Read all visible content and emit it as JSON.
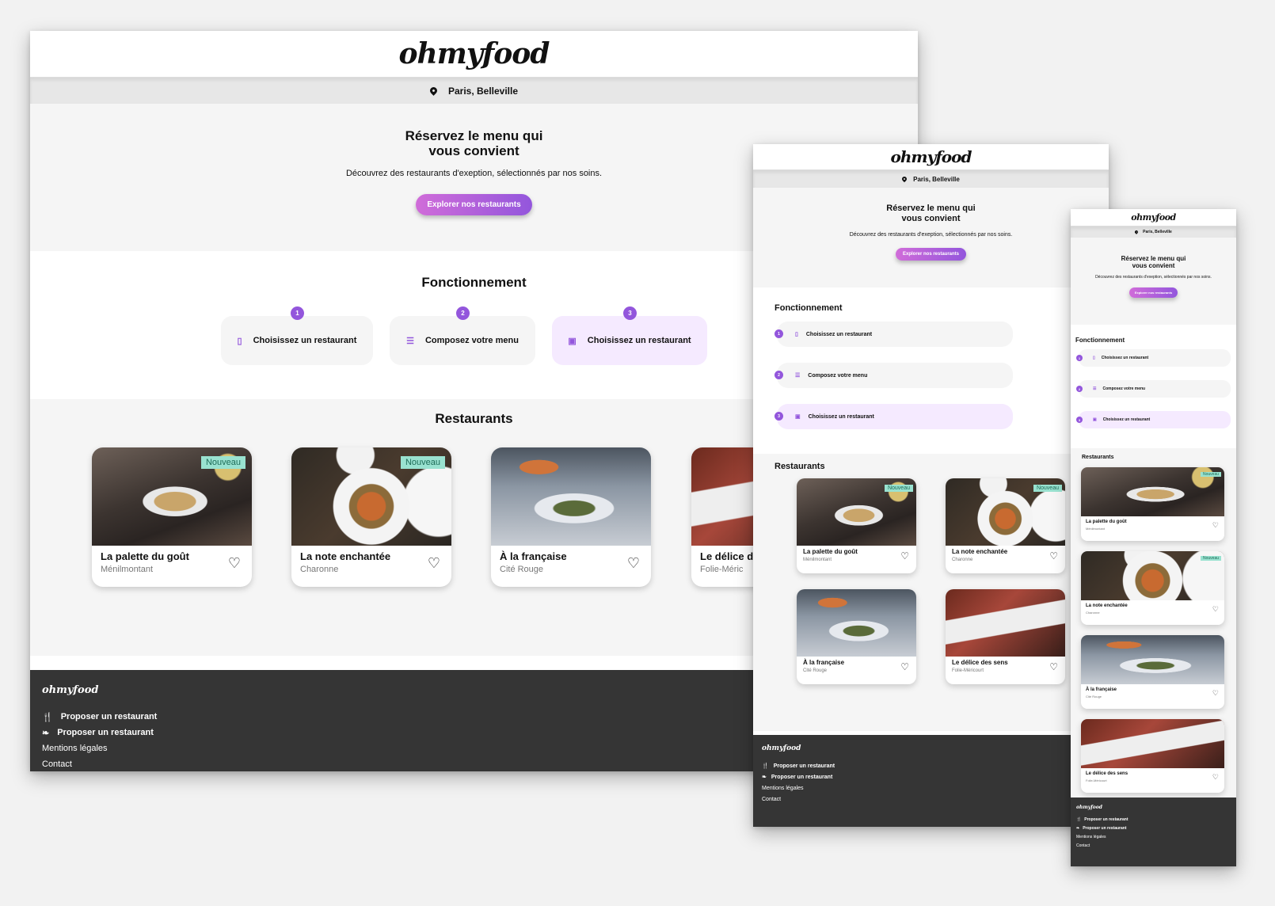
{
  "brand": {
    "logo": "ohmyfood",
    "accent": "#9356dc",
    "gradient_start": "#d06cd9",
    "badge_bg": "#99e2d0",
    "footer_bg": "#353535"
  },
  "location": {
    "text": "Paris, Belleville",
    "icon": "map-pin-icon"
  },
  "hero": {
    "title_line1": "Réservez le menu qui",
    "title_line2": "vous convient",
    "subtitle": "Découvrez des restaurants d'exeption, sélectionnés par nos soins.",
    "cta": "Explorer nos restaurants"
  },
  "how": {
    "title": "Fonctionnement",
    "steps": [
      {
        "num": "1",
        "icon": "phone-icon",
        "label": "Choisissez un restaurant"
      },
      {
        "num": "2",
        "icon": "list-icon",
        "label": "Composez votre menu"
      },
      {
        "num": "3",
        "icon": "store-icon",
        "label": "Choisissez un restaurant"
      }
    ]
  },
  "restaurants": {
    "title": "Restaurants",
    "items": [
      {
        "name": "La palette du goût",
        "area": "Ménilmontant",
        "badge": "Nouveau"
      },
      {
        "name": "La note enchantée",
        "area": "Charonne",
        "badge": "Nouveau"
      },
      {
        "name": "À la française",
        "area": "Cité Rouge",
        "badge": ""
      },
      {
        "name": "Le délice des sens",
        "area": "Folie-Méricourt",
        "badge": ""
      }
    ],
    "desktop_truncated_name": "Le délice d",
    "desktop_truncated_area": "Folie-Méric"
  },
  "footer": {
    "logo": "ohmyfood",
    "links": [
      {
        "label": "Proposer un restaurant",
        "icon": "utensils-icon"
      },
      {
        "label": "Proposer un restaurant",
        "icon": "leaf-icon"
      },
      {
        "label": "Mentions légales",
        "icon": ""
      },
      {
        "label": "Contact",
        "icon": ""
      }
    ]
  }
}
